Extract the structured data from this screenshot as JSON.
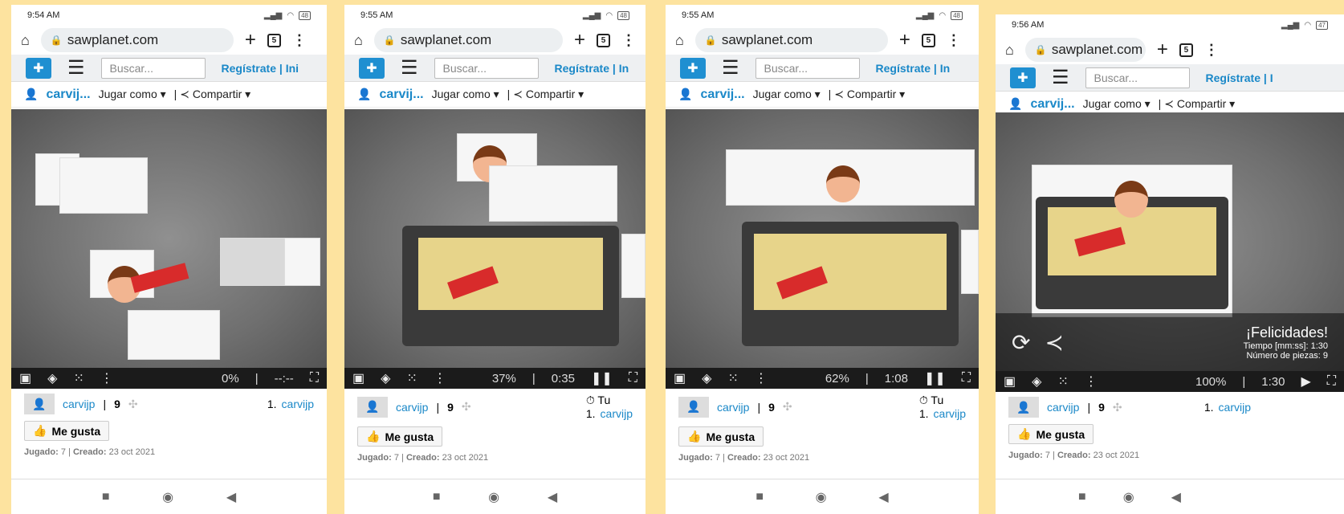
{
  "screens": [
    {
      "time": "9:54 AM",
      "battery": "48",
      "url": "sawplanet.com",
      "tabs": "5",
      "search_placeholder": "Buscar...",
      "register": "Regístrate",
      "login_partial": "Ini",
      "user": "carvij...",
      "play_as": "Jugar como",
      "share": "Compartir",
      "progress": "0%",
      "timer": "--:--",
      "creator": "carvijp",
      "pieces": "9",
      "rank_label": "",
      "rank": "1.",
      "rank_user": "carvijp",
      "like": "Me gusta",
      "meta_played_label": "Jugado:",
      "meta_played": "7",
      "meta_created_label": "Creado:",
      "meta_created": "23 oct 2021"
    },
    {
      "time": "9:55 AM",
      "battery": "48",
      "url": "sawplanet.com",
      "tabs": "5",
      "search_placeholder": "Buscar...",
      "register": "Regístrate",
      "login_partial": "In",
      "user": "carvij...",
      "play_as": "Jugar como",
      "share": "Compartir",
      "progress": "37%",
      "timer": "0:35",
      "creator": "carvijp",
      "pieces": "9",
      "rank_label": "Tu",
      "rank": "1.",
      "rank_user": "carvijp",
      "like": "Me gusta",
      "meta_played_label": "Jugado:",
      "meta_played": "7",
      "meta_created_label": "Creado:",
      "meta_created": "23 oct 2021"
    },
    {
      "time": "9:55 AM",
      "battery": "48",
      "url": "sawplanet.com",
      "tabs": "5",
      "search_placeholder": "Buscar...",
      "register": "Regístrate",
      "login_partial": "In",
      "user": "carvij...",
      "play_as": "Jugar como",
      "share": "Compartir",
      "progress": "62%",
      "timer": "1:08",
      "creator": "carvijp",
      "pieces": "9",
      "rank_label": "Tu",
      "rank": "1.",
      "rank_user": "carvijp",
      "like": "Me gusta",
      "meta_played_label": "Jugado:",
      "meta_played": "7",
      "meta_created_label": "Creado:",
      "meta_created": "23 oct 2021"
    },
    {
      "time": "9:56 AM",
      "battery": "47",
      "url": "sawplanet.com",
      "tabs": "5",
      "search_placeholder": "Buscar...",
      "register": "Regístrate",
      "login_partial": "I",
      "user": "carvij...",
      "play_as": "Jugar como",
      "share": "Compartir",
      "progress": "100%",
      "timer": "1:30",
      "creator": "carvijp",
      "pieces": "9",
      "rank_label": "",
      "rank": "1.",
      "rank_user": "carvijp",
      "like": "Me gusta",
      "meta_played_label": "Jugado:",
      "meta_played": "7",
      "meta_created_label": "Creado:",
      "meta_created": "23 oct 2021"
    }
  ],
  "complete": {
    "title": "¡Felicidades!",
    "time_label": "Tiempo [mm:ss]:",
    "time": "1:30",
    "pieces_label": "Número de piezas:",
    "pieces": "9"
  },
  "colors": {
    "background": "#fde39f",
    "accent": "#1a88c8"
  }
}
